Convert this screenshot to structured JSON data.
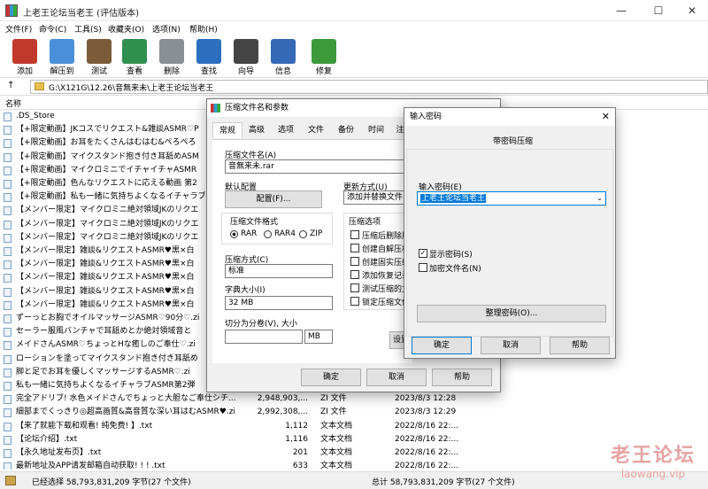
{
  "window": {
    "title": "上老王论坛当老王 (评估版本)",
    "min": "—",
    "max": "☐",
    "close": "✕"
  },
  "menu": [
    "文件(F)",
    "命令(C)",
    "工具(S)",
    "收藏夹(O)",
    "选项(N)",
    "帮助(H)"
  ],
  "toolbar": [
    {
      "label": "添加",
      "icon": "add-books-icon",
      "color": "#c0392b"
    },
    {
      "label": "解压到",
      "icon": "folder-extract-icon",
      "color": "#4a90d9"
    },
    {
      "label": "测试",
      "icon": "test-clipboard-icon",
      "color": "#7a5c3a"
    },
    {
      "label": "查看",
      "icon": "view-book-icon",
      "color": "#2f8f4e"
    },
    {
      "label": "删除",
      "icon": "trash-icon",
      "color": "#8a8f96"
    },
    {
      "label": "查找",
      "icon": "magnifier-icon",
      "color": "#2c6fbf"
    },
    {
      "label": "向导",
      "icon": "magic-wand-icon",
      "color": "#444"
    },
    {
      "label": "信息",
      "icon": "info-icon",
      "color": "#3568b5"
    },
    {
      "label": "修复",
      "icon": "repair-kit-icon",
      "color": "#3c9a3c"
    }
  ],
  "address": {
    "path": "G:\\X121G\\12.26\\音無来未\\上老王论坛当老王"
  },
  "columns": {
    "name": "名称"
  },
  "files": [
    {
      "name": ".DS_Store",
      "size": "",
      "type": "",
      "date": ""
    },
    {
      "name": "【+限定動画】JKコスでリクエスト&雑談ASMR♡P",
      "size": "",
      "type": "",
      "date": ""
    },
    {
      "name": "【+限定動画】お耳をたくさんはむはむ&ぺろぺろ",
      "size": "",
      "type": "",
      "date": ""
    },
    {
      "name": "【+限定動画】マイクスタンド抱き付き耳舐めASM",
      "size": "",
      "type": "",
      "date": ""
    },
    {
      "name": "【+限定動画】マイクロミニでイチャイチャASMR",
      "size": "",
      "type": "",
      "date": ""
    },
    {
      "name": "【+限定動画】色んなリクエストに応える動画 第2",
      "size": "",
      "type": "",
      "date": ""
    },
    {
      "name": "【+限定動画】私も一緒に気持ちよくなるイチャラブ",
      "size": "",
      "type": "",
      "date": ""
    },
    {
      "name": "【メンバー限定】マイクロミニ絶対領域JKのリクエ",
      "size": "",
      "type": "",
      "date": ""
    },
    {
      "name": "【メンバー限定】マイクロミニ絶対領域JKのリクエ",
      "size": "",
      "type": "",
      "date": ""
    },
    {
      "name": "【メンバー限定】マイクロミニ絶対領域JKのリクエ",
      "size": "",
      "type": "",
      "date": ""
    },
    {
      "name": "【メンバー限定】雑談&リクエストASMR♥黒×白",
      "size": "",
      "type": "",
      "date": ""
    },
    {
      "name": "【メンバー限定】雑談&リクエストASMR♥黒×白",
      "size": "",
      "type": "",
      "date": ""
    },
    {
      "name": "【メンバー限定】雑談&リクエストASMR♥黒×白",
      "size": "",
      "type": "",
      "date": ""
    },
    {
      "name": "【メンバー限定】雑談&リクエストASMR♥黒×白",
      "size": "",
      "type": "",
      "date": ""
    },
    {
      "name": "【メンバー限定】雑談&リクエストASMR♥黒×白",
      "size": "",
      "type": "",
      "date": ""
    },
    {
      "name": "ずーっとお胸でオイルマッサージASMR♡90分♡.zi",
      "size": "",
      "type": "",
      "date": ""
    },
    {
      "name": "セーラー服風バンチャで耳舐めとか絶対領域音と",
      "size": "",
      "type": "",
      "date": ""
    },
    {
      "name": "メイドさんASMR♡ちょっとHな癒しのご奉仕♡.zi",
      "size": "",
      "type": "",
      "date": ""
    },
    {
      "name": "ローションを塗ってマイクスタンド抱き付き耳舐め",
      "size": "",
      "type": "",
      "date": ""
    },
    {
      "name": "脚と足でお耳を優しくマッサージするASMR♡.zi",
      "size": "",
      "type": "",
      "date": ""
    },
    {
      "name": "私も一緒に気持ちよくなるイチャラブASMR第2弾",
      "size": "",
      "type": "",
      "date": ""
    },
    {
      "name": "完全アドリブ! 水色メイドさんでちょっと大胆なご奉仕シチ...",
      "size": "2,948,903,...",
      "type": "ZI 文件",
      "date": "2023/8/3 12:28"
    },
    {
      "name": "細部までくっきり◎超高画質&高音質な深い耳はむASMR♥.zi",
      "size": "2,992,308,...",
      "type": "ZI 文件",
      "date": "2023/8/3 12:29"
    },
    {
      "name": "【来了就能下载和观看! 纯免费! 】.txt",
      "size": "1,112",
      "type": "文本文档",
      "date": "2022/8/16 22:..."
    },
    {
      "name": "【论坛介绍】.txt",
      "size": "1,116",
      "type": "文本文档",
      "date": "2022/8/16 22:..."
    },
    {
      "name": "【永久地址发布页】.txt",
      "size": "201",
      "type": "文本文档",
      "date": "2022/8/16 22:..."
    },
    {
      "name": "最新地址及APP请发邮箱自动获取! ! ! .txt",
      "size": "633",
      "type": "文本文档",
      "date": "2022/8/16 22:..."
    }
  ],
  "status": {
    "left": "已经选择 58,793,831,209 字节(27 个文件)",
    "right": "总计 58,793,831,209 字节(27 个文件)"
  },
  "archive_dialog": {
    "title": "压缩文件名和参数",
    "tabs": [
      "常规",
      "高级",
      "选项",
      "文件",
      "备份",
      "时间",
      "注"
    ],
    "filename_label": "压缩文件名(A)",
    "filename": "音無来未.rar",
    "default_profile_label": "默认配置",
    "profile_button": "配置(F)...",
    "update_label": "更新方式(U)",
    "update_value": "添加并替换文件",
    "format_label": "压缩文件格式",
    "formats": [
      "RAR",
      "RAR4",
      "ZIP"
    ],
    "method_label": "压缩方式(C)",
    "method": "标准",
    "dict_label": "字典大小(I)",
    "dict": "32 MB",
    "split_label": "切分为分卷(V), 大小",
    "split_unit": "MB",
    "options_label": "压缩选项",
    "options": [
      "压缩后删除原",
      "创建自解压格",
      "创建固实压缩",
      "添加恢复记录",
      "测试压缩的文",
      "锁定压缩文件"
    ],
    "set_password_button": "设置",
    "ok": "确定",
    "cancel": "取消",
    "help": "帮助"
  },
  "password_dialog": {
    "title": "输入密码",
    "heading": "带密码压缩",
    "password_label": "输入密码(E)",
    "password": "上老王论坛当老王",
    "show_password": "显示密码(S)",
    "encrypt_names": "加密文件名(N)",
    "manage_button": "整理密码(O)...",
    "ok": "确定",
    "cancel": "取消",
    "help": "帮助"
  },
  "watermark": {
    "line1": "老王论坛",
    "line2": "laowang.vip"
  }
}
